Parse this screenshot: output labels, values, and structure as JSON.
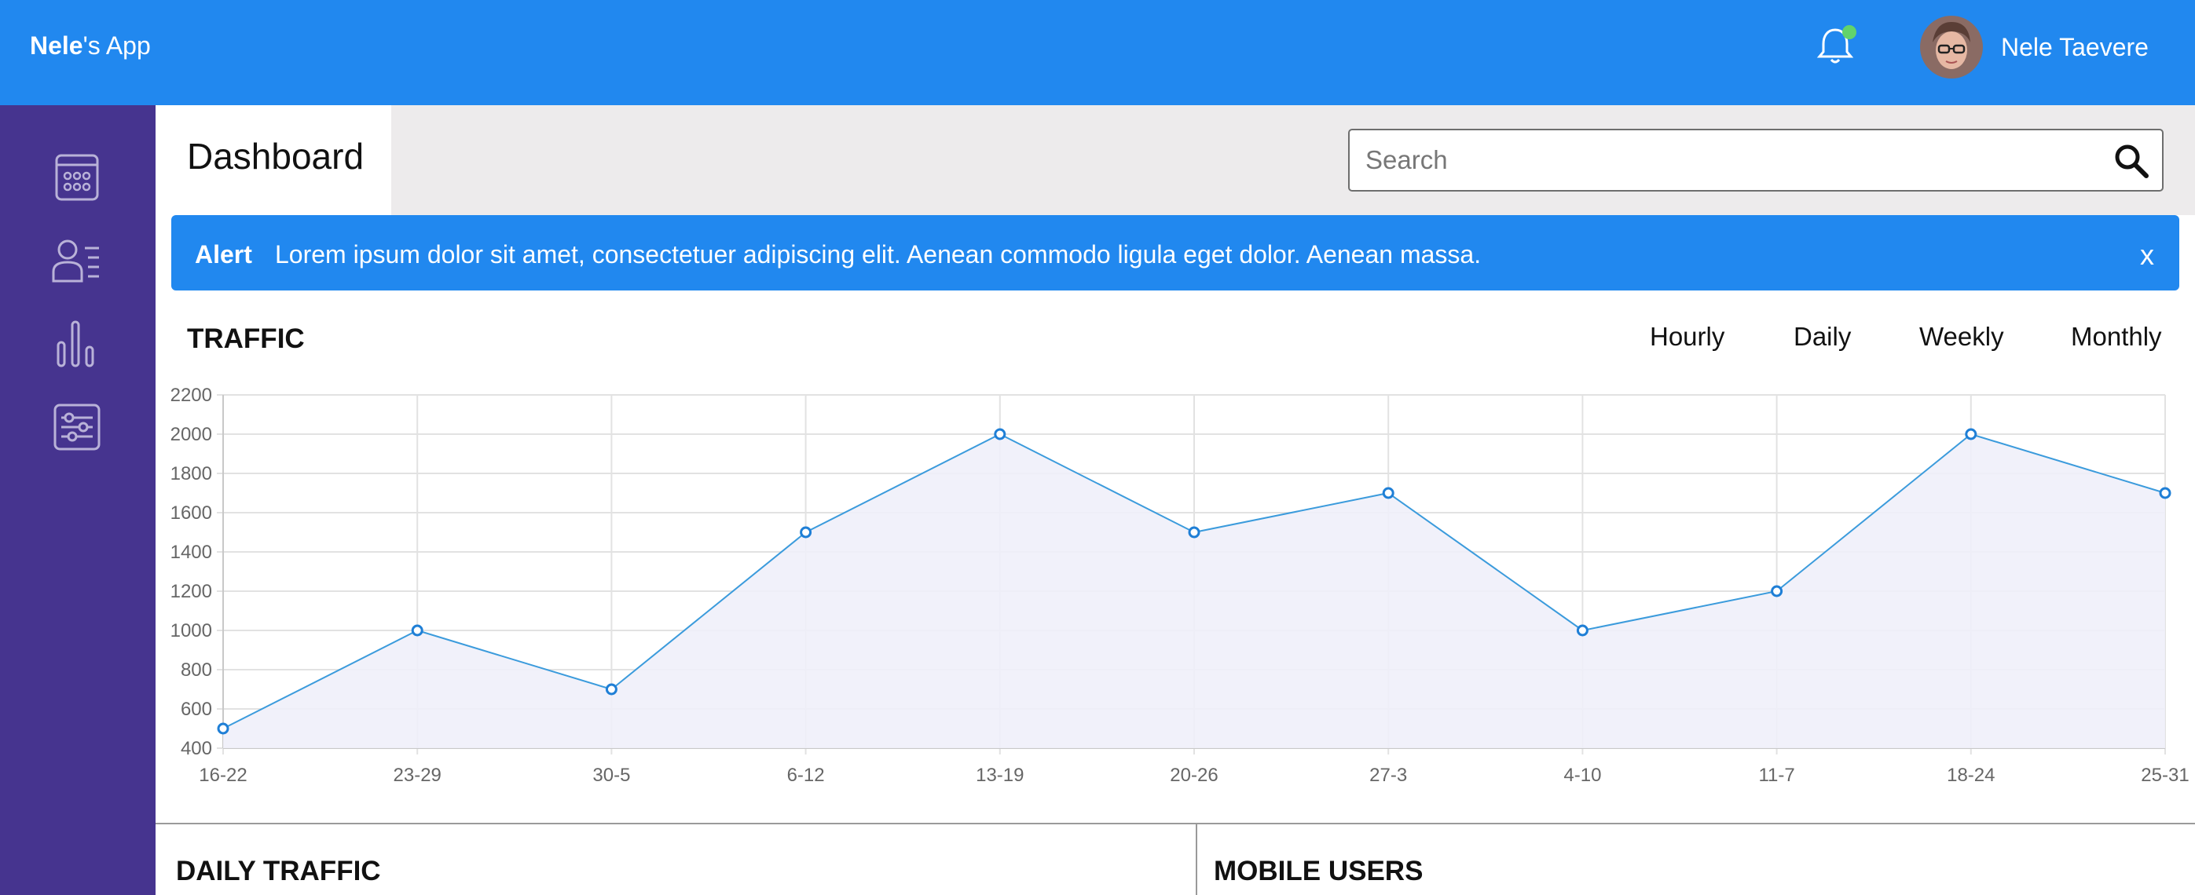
{
  "header": {
    "brand_bold": "Nele",
    "brand_rest": "'s App",
    "user_name": "Nele Taevere",
    "icons": {
      "notification": "bell-icon",
      "notification_status": "online-dot"
    }
  },
  "sidebar": {
    "items": [
      {
        "icon": "calendar-icon"
      },
      {
        "icon": "users-list-icon"
      },
      {
        "icon": "bar-chart-icon"
      },
      {
        "icon": "settings-sliders-icon"
      }
    ]
  },
  "page": {
    "title": "Dashboard",
    "search_placeholder": "Search"
  },
  "alert": {
    "label": "Alert",
    "message": "Lorem ipsum dolor sit amet, consectetuer adipiscing elit. Aenean commodo ligula eget dolor. Aenean massa.",
    "close": "x"
  },
  "traffic": {
    "title": "TRAFFIC",
    "tabs": [
      "Hourly",
      "Daily",
      "Weekly",
      "Monthly"
    ]
  },
  "panels": {
    "left_title": "DAILY TRAFFIC",
    "right_title": "MOBILE USERS"
  },
  "colors": {
    "header": "#2188ef",
    "sidebar": "#46348f",
    "line": "#3b9bdc",
    "fill": "#f0f0fa",
    "online_dot": "#62d36b"
  },
  "chart_data": {
    "type": "area",
    "x": [
      "16-22",
      "23-29",
      "30-5",
      "6-12",
      "13-19",
      "20-26",
      "27-3",
      "4-10",
      "11-7",
      "18-24",
      "25-31"
    ],
    "series": [
      {
        "values": [
          500,
          1000,
          700,
          1500,
          2000,
          1500,
          1700,
          1000,
          1200,
          2000,
          1700
        ]
      }
    ],
    "ylim": [
      400,
      2200
    ],
    "yticks": [
      400,
      600,
      800,
      1000,
      1200,
      1400,
      1600,
      1800,
      2000,
      2200
    ],
    "grid": true,
    "title": "",
    "xlabel": "",
    "ylabel": ""
  }
}
